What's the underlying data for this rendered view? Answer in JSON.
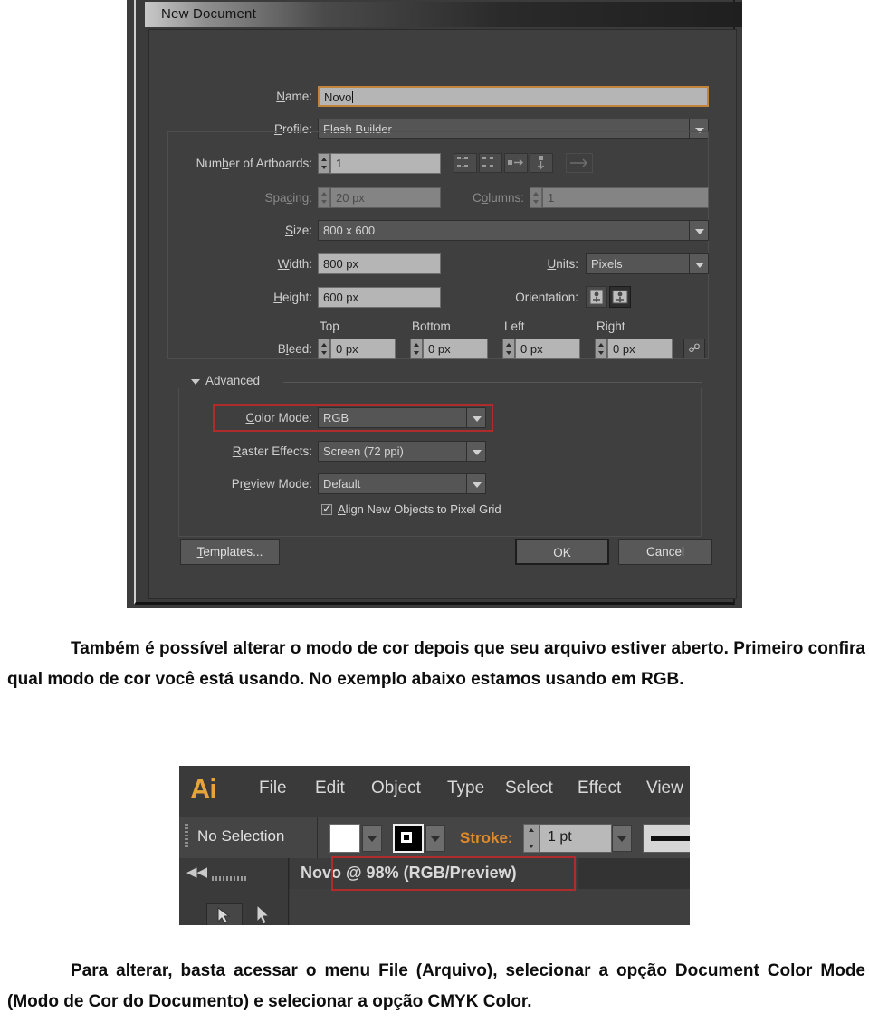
{
  "new_document_dialog": {
    "title": "New Document",
    "fields": {
      "name_label": "Name:",
      "name_value": "Novo",
      "profile_label": "Profile:",
      "profile_value": "Flash Builder",
      "artboards_label": "Number of Artboards:",
      "artboards_value": "1",
      "spacing_label": "Spacing:",
      "spacing_value": "20 px",
      "columns_label": "Columns:",
      "columns_value": "1",
      "size_label": "Size:",
      "size_value": "800 x 600",
      "width_label": "Width:",
      "width_value": "800 px",
      "units_label": "Units:",
      "units_value": "Pixels",
      "height_label": "Height:",
      "height_value": "600 px",
      "orientation_label": "Orientation:",
      "bleed_label": "Bleed:",
      "bleed_top_header": "Top",
      "bleed_bottom_header": "Bottom",
      "bleed_left_header": "Left",
      "bleed_right_header": "Right",
      "bleed_top_value": "0 px",
      "bleed_bottom_value": "0 px",
      "bleed_left_value": "0 px",
      "bleed_right_value": "0 px"
    },
    "advanced": {
      "section_label": "Advanced",
      "color_mode_label": "Color Mode:",
      "color_mode_value": "RGB",
      "raster_effects_label": "Raster Effects:",
      "raster_effects_value": "Screen (72 ppi)",
      "preview_mode_label": "Preview Mode:",
      "preview_mode_value": "Default",
      "align_pixel_grid_label": "Align New Objects to Pixel Grid",
      "align_pixel_grid_checked": true
    },
    "buttons": {
      "templates": "Templates...",
      "ok": "OK",
      "cancel": "Cancel"
    },
    "highlight_color": "#b02b2b",
    "focus_color": "#c2833a"
  },
  "paragraph_top": "Também é possível alterar o modo de cor depois que seu arquivo estiver aberto. Primeiro confira qual modo de cor você está usando. No exemplo abaixo estamos usando em RGB.",
  "illustrator_bar": {
    "logo": "Ai",
    "menus": [
      "File",
      "Edit",
      "Object",
      "Type",
      "Select",
      "Effect",
      "View"
    ],
    "control_bar": {
      "selection_status": "No Selection",
      "fill_color": "#ffffff",
      "stroke_label": "Stroke:",
      "stroke_weight": "1 pt"
    },
    "document_tab": {
      "title": "Novo @ 98% (RGB/Preview)",
      "close_glyph": "×"
    },
    "collapse_glyph": "◀◀",
    "accent_color": "#e08b2a",
    "highlight_color": "#b02b2b"
  },
  "paragraph_bottom": "Para alterar, basta acessar o menu File (Arquivo), selecionar a opção Document Color Mode (Modo de Cor do Documento) e selecionar a opção CMYK Color."
}
